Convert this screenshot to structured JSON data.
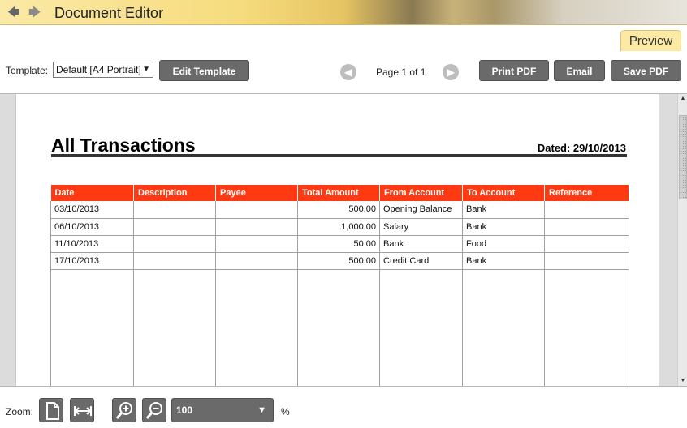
{
  "window": {
    "title": "Document Editor"
  },
  "nav": {
    "back_icon": "back-arrow-icon",
    "forward_icon": "forward-arrow-icon"
  },
  "tabs": [
    {
      "label": "Preview",
      "active": true
    }
  ],
  "toolbar": {
    "template_label": "Template:",
    "template_value": "Default [A4 Portrait]",
    "edit_template": "Edit Template",
    "page_label": "Page 1 of 1",
    "print_pdf": "Print PDF",
    "email": "Email",
    "save_pdf": "Save PDF"
  },
  "document": {
    "title": "All Transactions",
    "dated": "Dated: 29/10/2013",
    "columns": [
      "Date",
      "Description",
      "Payee",
      "Total Amount",
      "From Account",
      "To Account",
      "Reference"
    ],
    "rows": [
      [
        "03/10/2013",
        "",
        "",
        "500.00",
        "Opening Balance",
        "Bank",
        ""
      ],
      [
        "06/10/2013",
        "",
        "",
        "1,000.00",
        "Salary",
        "Bank",
        ""
      ],
      [
        "11/10/2013",
        "",
        "",
        "50.00",
        "Bank",
        "Food",
        ""
      ],
      [
        "17/10/2013",
        "",
        "",
        "500.00",
        "Credit Card",
        "Bank",
        ""
      ]
    ],
    "header_color": "#ff3a12"
  },
  "zoom": {
    "label": "Zoom:",
    "value": "100",
    "unit": "%"
  },
  "colors": {
    "tab_accent": "#fbe9a4",
    "button": "#6a6a6a"
  }
}
